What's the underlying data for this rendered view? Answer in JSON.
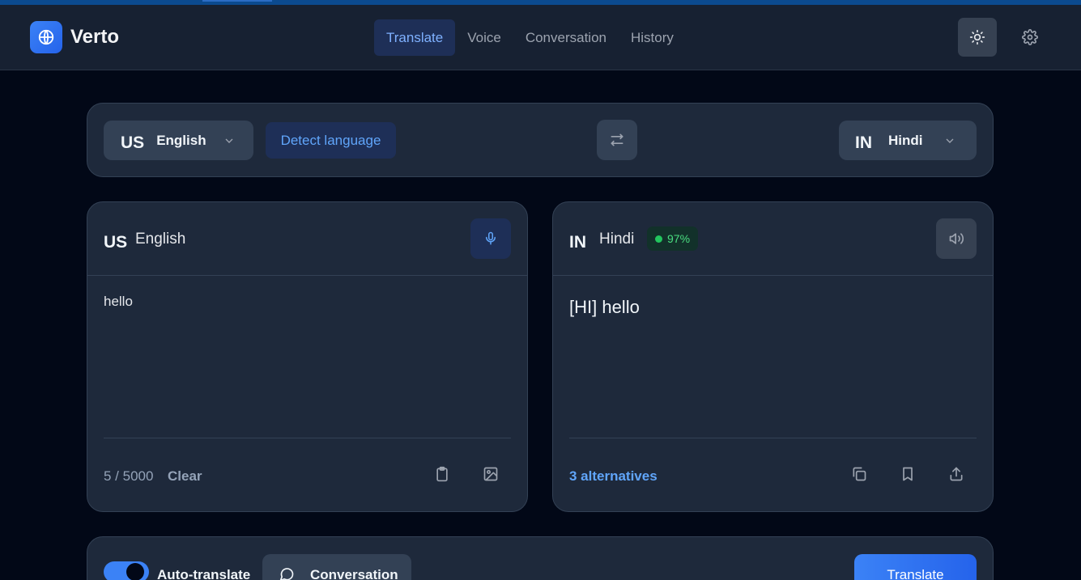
{
  "app": {
    "name": "Verto"
  },
  "nav": {
    "tabs": [
      {
        "label": "Translate",
        "active": true
      },
      {
        "label": "Voice",
        "active": false
      },
      {
        "label": "Conversation",
        "active": false
      },
      {
        "label": "History",
        "active": false
      }
    ]
  },
  "header_icons": {
    "theme": "sun-icon",
    "settings": "gear-icon"
  },
  "language_bar": {
    "source": {
      "code": "US",
      "name": "English"
    },
    "detect_label": "Detect language",
    "swap_icon": "swap-arrows-icon",
    "target": {
      "code": "IN",
      "name": "Hindi"
    }
  },
  "source_card": {
    "code": "US",
    "name": "English",
    "text": "hello",
    "counter": "5 / 5000",
    "clear_label": "Clear"
  },
  "target_card": {
    "code": "IN",
    "name": "Hindi",
    "confidence": "97%",
    "output": "[HI] hello",
    "alternatives_label": "3 alternatives"
  },
  "bottom_bar": {
    "auto_translate_label": "Auto-translate",
    "auto_translate_on": true,
    "conversation_label": "Conversation",
    "translate_label": "Translate"
  },
  "colors": {
    "accent": "#3b82f6",
    "accent_text": "#60a5fa",
    "background": "#020817",
    "panel": "#1e293b",
    "success": "#22c55e"
  }
}
